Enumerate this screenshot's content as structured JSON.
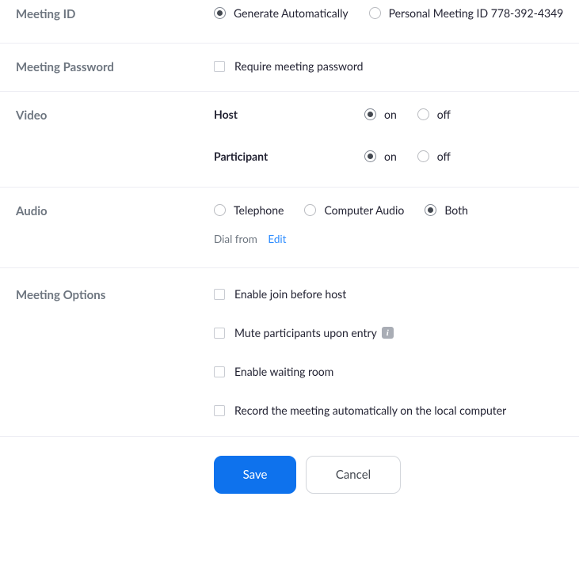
{
  "meeting_id": {
    "label": "Meeting ID",
    "options": {
      "auto": "Generate Automatically",
      "pmi": "Personal Meeting ID 778-392-4349"
    },
    "selected": "auto"
  },
  "password": {
    "label": "Meeting Password",
    "require_label": "Require meeting password",
    "require_checked": false
  },
  "video": {
    "label": "Video",
    "host_label": "Host",
    "participant_label": "Participant",
    "on_label": "on",
    "off_label": "off",
    "host_value": "on",
    "participant_value": "on"
  },
  "audio": {
    "label": "Audio",
    "options": {
      "telephone": "Telephone",
      "computer": "Computer Audio",
      "both": "Both"
    },
    "selected": "both",
    "dial_from_label": "Dial from",
    "edit_label": "Edit"
  },
  "options": {
    "label": "Meeting Options",
    "items": {
      "join_before_host": {
        "label": "Enable join before host",
        "checked": false
      },
      "mute_on_entry": {
        "label": "Mute participants upon entry",
        "checked": false,
        "info": true
      },
      "waiting_room": {
        "label": "Enable waiting room",
        "checked": false
      },
      "auto_record": {
        "label": "Record the meeting automatically on the local computer",
        "checked": false
      }
    }
  },
  "footer": {
    "save": "Save",
    "cancel": "Cancel"
  }
}
